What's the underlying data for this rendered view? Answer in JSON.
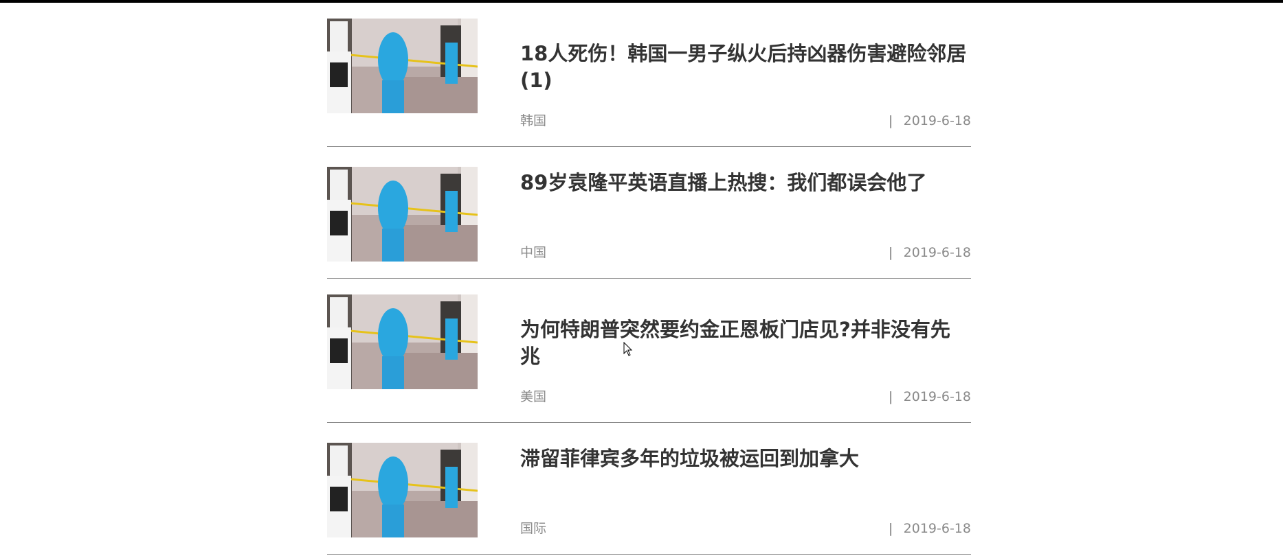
{
  "colors": {
    "background": "#ffffff",
    "title": "#333333",
    "meta": "#8a8a8a",
    "divider": "#8a8a8a",
    "top_bar": "#000000"
  },
  "news": [
    {
      "title": "18人死伤！韩国一男子纵火后持凶器伤害避险邻居(1)",
      "category": "韩国",
      "separator": "|",
      "date": "2019-6-18"
    },
    {
      "title": "89岁袁隆平英语直播上热搜：我们都误会他了",
      "category": "中国",
      "separator": "|",
      "date": "2019-6-18"
    },
    {
      "title": "为何特朗普突然要约金正恩板门店见?并非没有先兆",
      "category": "美国",
      "separator": "|",
      "date": "2019-6-18"
    },
    {
      "title": "滞留菲律宾多年的垃圾被运回到加拿大",
      "category": "国际",
      "separator": "|",
      "date": "2019-6-18"
    }
  ]
}
